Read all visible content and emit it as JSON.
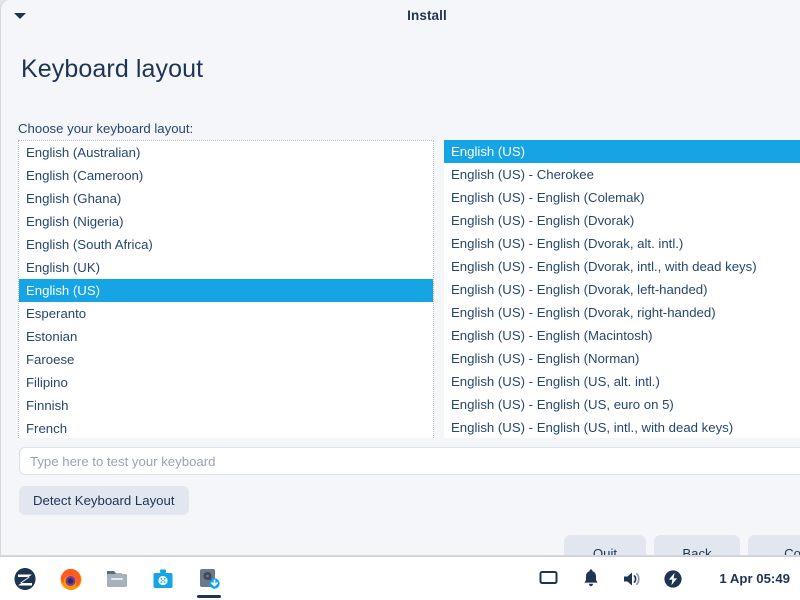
{
  "window": {
    "title": "Install",
    "menu_icon": "chevron-down-icon",
    "page_title": "Keyboard layout",
    "choose_label": "Choose your keyboard layout:"
  },
  "layout_list": {
    "selected": "English (US)",
    "items": [
      "English (Australian)",
      "English (Cameroon)",
      "English (Ghana)",
      "English (Nigeria)",
      "English (South Africa)",
      "English (UK)",
      "English (US)",
      "Esperanto",
      "Estonian",
      "Faroese",
      "Filipino",
      "Finnish",
      "French"
    ]
  },
  "variant_list": {
    "selected": "English (US)",
    "items": [
      "English (US)",
      "English (US) - Cherokee",
      "English (US) - English (Colemak)",
      "English (US) - English (Dvorak)",
      "English (US) - English (Dvorak, alt. intl.)",
      "English (US) - English (Dvorak, intl., with dead keys)",
      "English (US) - English (Dvorak, left-handed)",
      "English (US) - English (Dvorak, right-handed)",
      "English (US) - English (Macintosh)",
      "English (US) - English (Norman)",
      "English (US) - English (US, alt. intl.)",
      "English (US) - English (US, euro on 5)",
      "English (US) - English (US, intl., with dead keys)"
    ]
  },
  "test_input": {
    "value": "",
    "placeholder": "Type here to test your keyboard"
  },
  "buttons": {
    "detect": "Detect Keyboard Layout",
    "quit": "Quit",
    "back": "Back",
    "continue": "Cont"
  },
  "taskbar": {
    "apps": [
      {
        "name": "zorin-menu-icon",
        "active": false
      },
      {
        "name": "firefox-icon",
        "active": false
      },
      {
        "name": "files-icon",
        "active": false
      },
      {
        "name": "software-center-icon",
        "active": false
      },
      {
        "name": "installer-icon",
        "active": true
      }
    ],
    "tray": [
      {
        "name": "display-icon"
      },
      {
        "name": "bell-icon"
      },
      {
        "name": "volume-icon"
      },
      {
        "name": "power-icon"
      }
    ],
    "clock": "1 Apr 05:49"
  },
  "colors": {
    "accent": "#15a5e5",
    "text_dark": "#1d3453",
    "text_body": "#25476e",
    "window_bg": "#f4f6f9",
    "button_bg": "#e2e6ee"
  }
}
